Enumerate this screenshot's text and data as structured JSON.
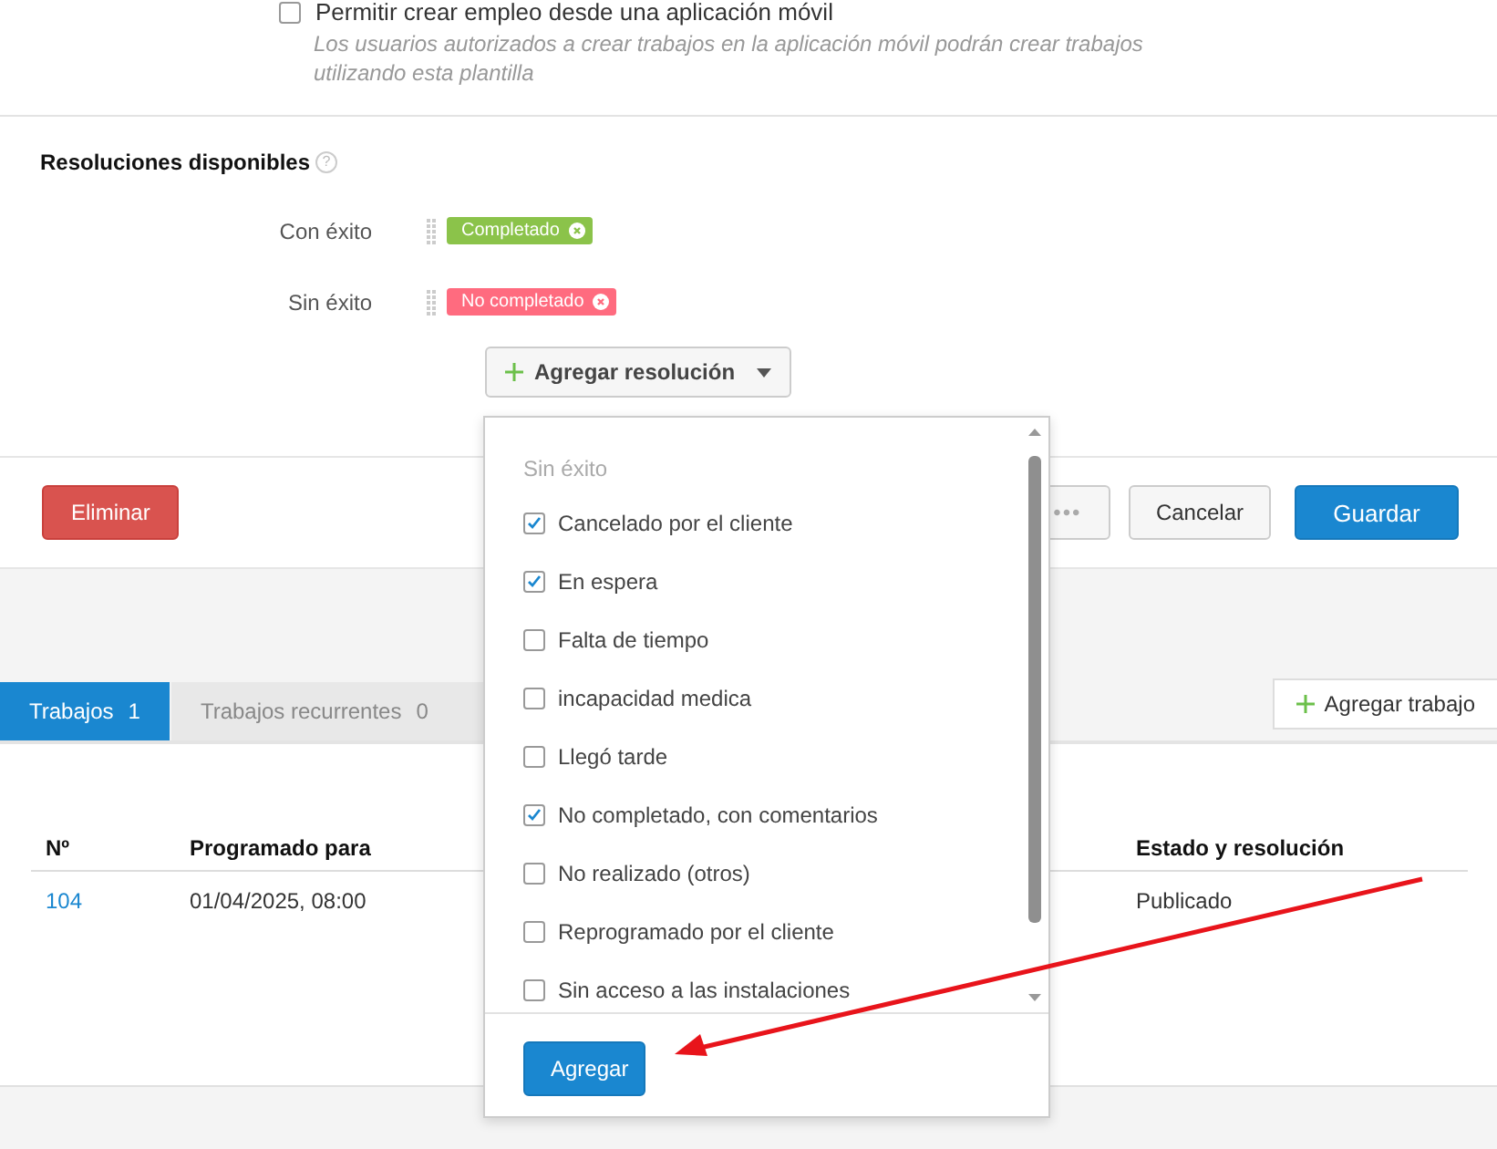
{
  "mobile_option": {
    "label": "Permitir crear empleo desde una aplicación móvil",
    "checked": false,
    "description": "Los usuarios autorizados a crear trabajos en la aplicación móvil podrán crear trabajos utilizando esta plantilla"
  },
  "resolutions": {
    "title": "Resoluciones disponibles",
    "groups": [
      {
        "label": "Con éxito",
        "tag": "Completado",
        "color": "#8bc34a"
      },
      {
        "label": "Sin éxito",
        "tag": "No completado",
        "color": "#ff6b7f"
      }
    ],
    "add_button": "Agregar resolución",
    "help": "?"
  },
  "dropdown": {
    "group": "Sin éxito",
    "items": [
      {
        "label": "Cancelado por el cliente",
        "checked": true
      },
      {
        "label": "En espera",
        "checked": true
      },
      {
        "label": "Falta de tiempo",
        "checked": false
      },
      {
        "label": "incapacidad medica",
        "checked": false
      },
      {
        "label": "Llegó tarde",
        "checked": false
      },
      {
        "label": "No completado, con comentarios",
        "checked": true
      },
      {
        "label": "No realizado (otros)",
        "checked": false
      },
      {
        "label": "Reprogramado por el cliente",
        "checked": false
      },
      {
        "label": "Sin acceso a las instalaciones",
        "checked": false
      }
    ],
    "button": "Agregar"
  },
  "footer": {
    "delete": "Eliminar",
    "more": "•••",
    "cancel": "Cancelar",
    "save": "Guardar"
  },
  "tabs": [
    {
      "label": "Trabajos",
      "count": "1",
      "selected": true
    },
    {
      "label": "Trabajos recurrentes",
      "count": "0",
      "selected": false
    }
  ],
  "add_job": "Agregar trabajo",
  "table": {
    "columns": [
      "Nº",
      "Programado para",
      "Estado y resolución"
    ],
    "rows": [
      [
        "104",
        "01/04/2025, 08:00",
        "Publicado"
      ]
    ]
  }
}
